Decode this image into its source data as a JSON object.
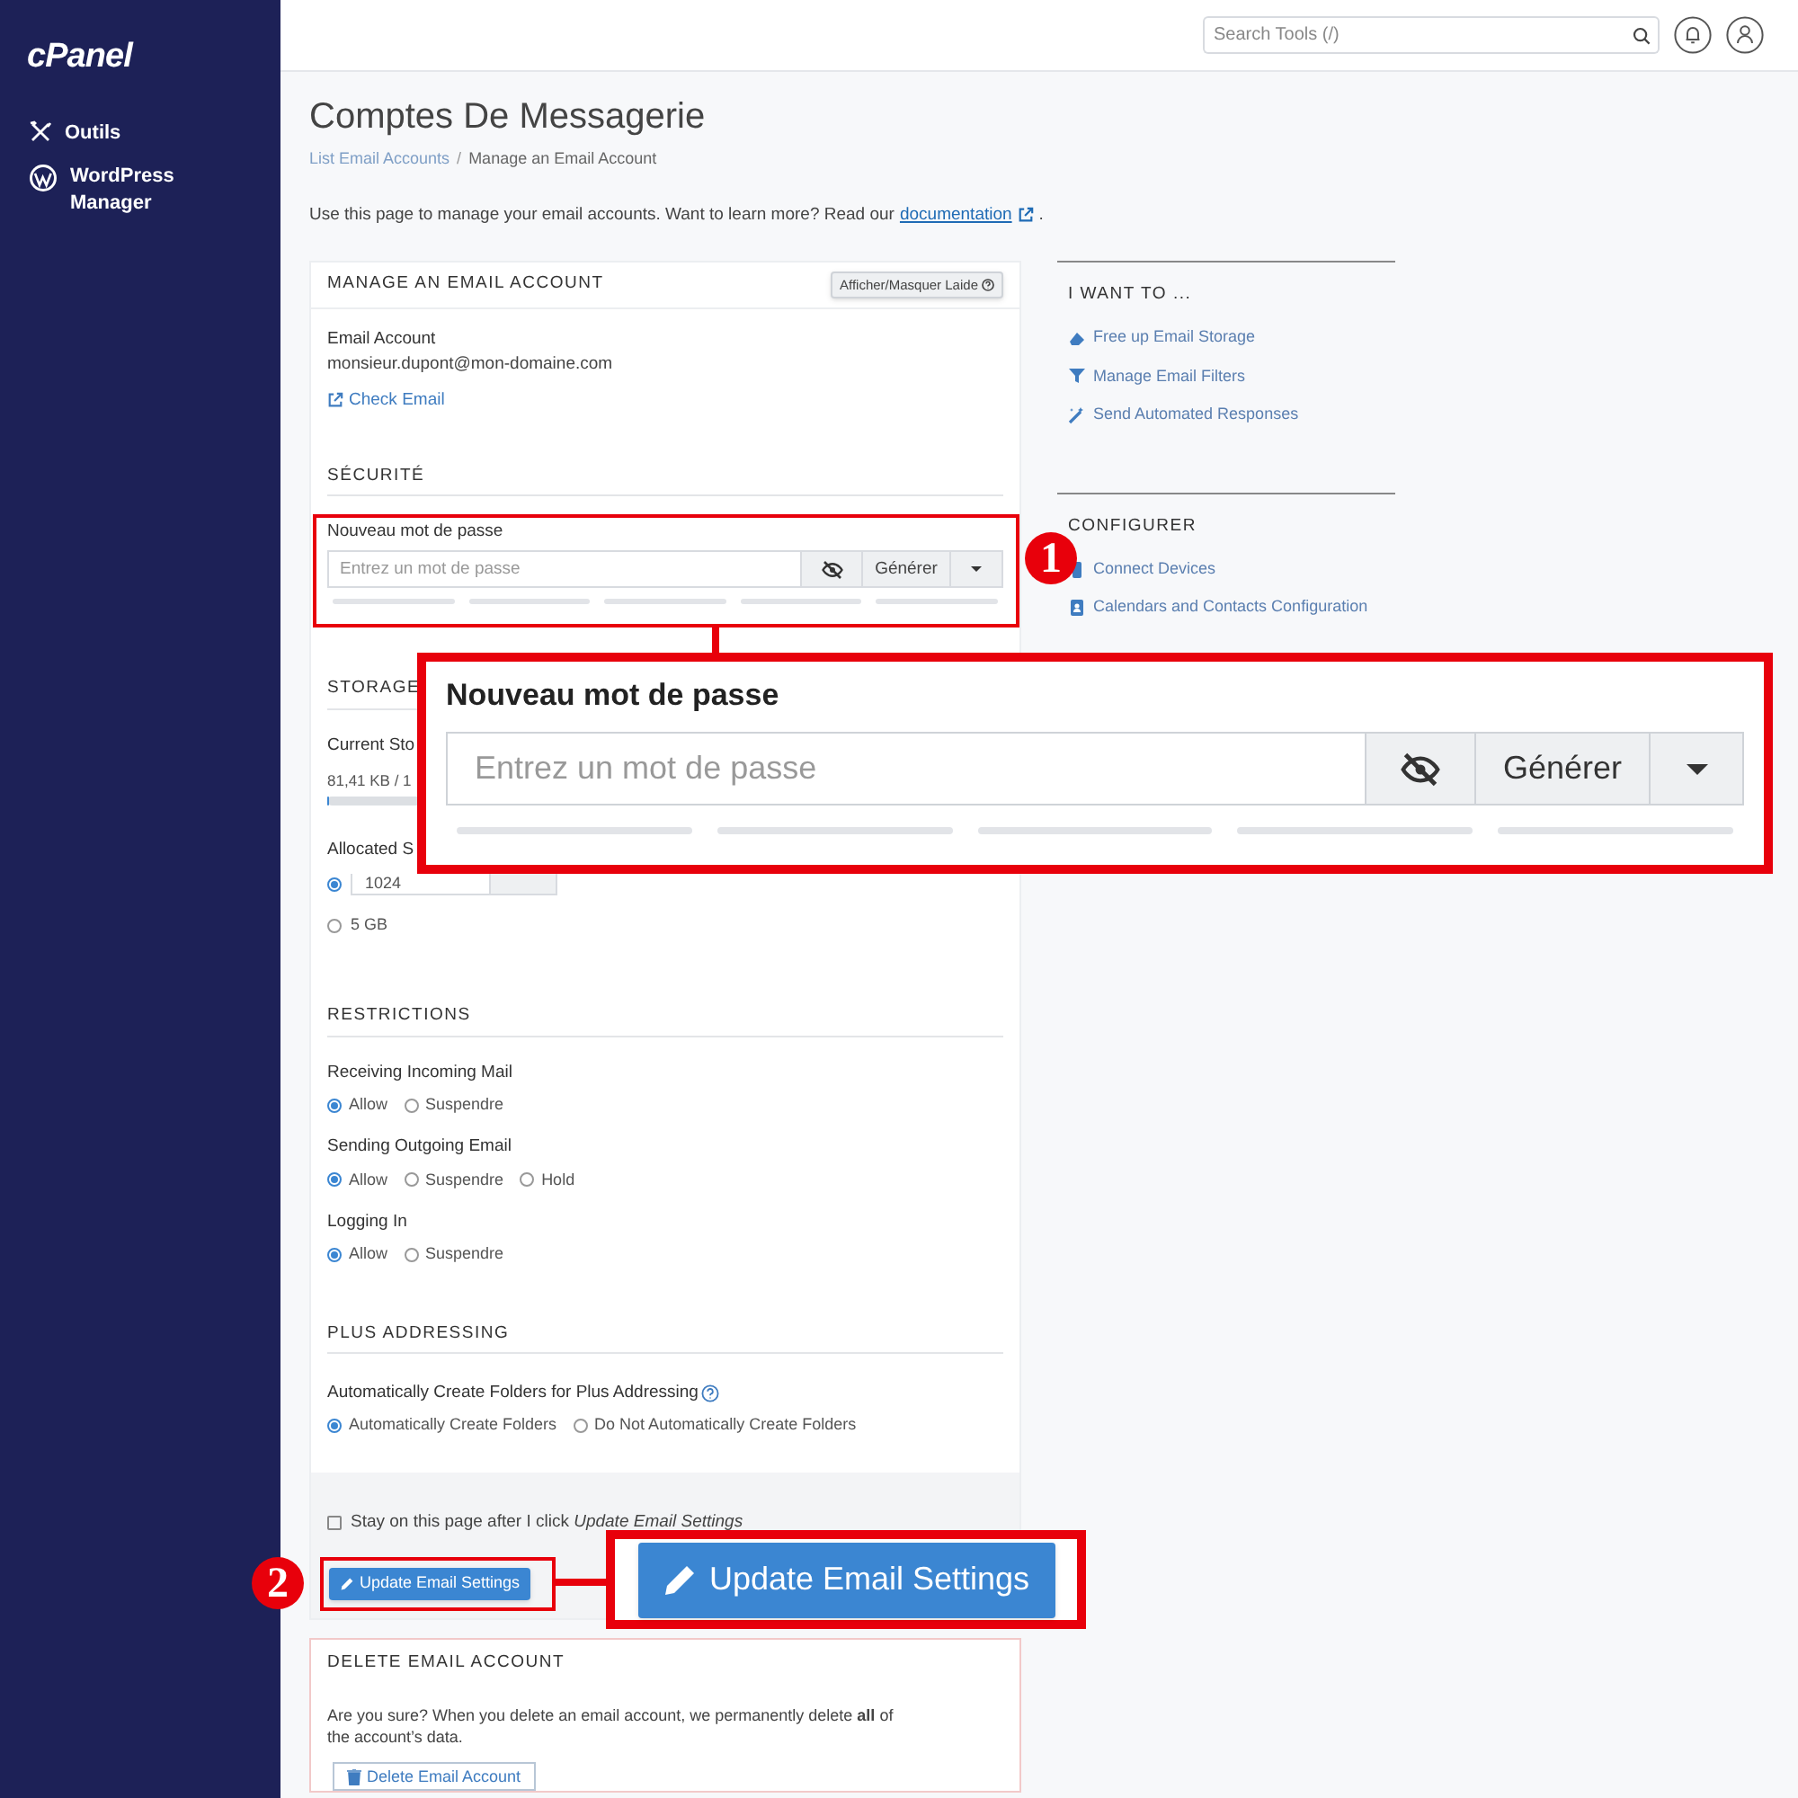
{
  "sidebar": {
    "logo": "cPanel",
    "items": [
      {
        "label": "Outils"
      },
      {
        "label": "WordPress Manager"
      }
    ]
  },
  "topbar": {
    "search": {
      "placeholder": "Search Tools (/)"
    }
  },
  "page": {
    "title": "Comptes De Messagerie",
    "breadcrumb": [
      {
        "label": "List Email Accounts",
        "link": true
      },
      {
        "label": "Manage an Email Account",
        "link": false
      }
    ],
    "breadcrumb_separator": "/",
    "description": "Use this page to manage your email accounts. Want to learn more? Read our",
    "doc_link": "documentation",
    "description_end": "."
  },
  "manage": {
    "heading": "MANAGE AN EMAIL ACCOUNT",
    "help_button": "Afficher/Masquer Laide",
    "email_label": "Email Account",
    "email_value": "monsieur.dupont@mon-domaine.com",
    "check_email": "Check Email",
    "security": {
      "heading": "SÉCURITÉ",
      "password_label": "Nouveau mot de passe",
      "placeholder": "Entrez un mot de passe",
      "generate": "Générer"
    },
    "storage": {
      "heading": "STORAGE",
      "current_label": "Current Sto",
      "current_value": "81,41 KB / 1",
      "level": 0.01,
      "allocated_label": "Allocated S",
      "options": [
        {
          "kind": "input",
          "value": "1024",
          "selected": true
        },
        {
          "kind": "text",
          "label": "5 GB",
          "selected": false
        }
      ]
    },
    "restrictions": {
      "heading": "RESTRICTIONS",
      "groups": [
        {
          "label": "Receiving Incoming Mail",
          "options": [
            {
              "label": "Allow",
              "selected": true
            },
            {
              "label": "Suspendre",
              "selected": false
            }
          ]
        },
        {
          "label": "Sending Outgoing Email",
          "options": [
            {
              "label": "Allow",
              "selected": true
            },
            {
              "label": "Suspendre",
              "selected": false
            },
            {
              "label": "Hold",
              "selected": false
            }
          ]
        },
        {
          "label": "Logging In",
          "options": [
            {
              "label": "Allow",
              "selected": true
            },
            {
              "label": "Suspendre",
              "selected": false
            }
          ]
        }
      ]
    },
    "plus": {
      "heading": "PLUS ADDRESSING",
      "question": "Automatically Create Folders for Plus Addressing",
      "options": [
        {
          "label": "Automatically Create Folders",
          "selected": true
        },
        {
          "label": "Do Not Automatically Create Folders",
          "selected": false
        }
      ]
    },
    "stay": {
      "label": "Stay on this page after I click *Update Email Settings*",
      "checked": false
    },
    "update_button": "Update Email Settings"
  },
  "delete": {
    "heading": "DELETE EMAIL ACCOUNT",
    "text": "Are you sure? When you delete an email account, we permanently delete **all** of the account’s data.",
    "button": "Delete Email Account"
  },
  "aside": [
    {
      "heading": "I WANT TO ...",
      "links": [
        {
          "label": "Free up Email Storage"
        },
        {
          "label": "Manage Email Filters"
        },
        {
          "label": "Send Automated Responses"
        }
      ]
    },
    {
      "heading": "CONFIGURER",
      "links": [
        {
          "label": "Connect Devices"
        },
        {
          "label": "Calendars and Contacts Configuration"
        }
      ]
    }
  ],
  "callouts": [
    {
      "number": "1",
      "label": "Nouveau mot de passe",
      "placeholder": "Entrez un mot de passe",
      "generate": "Générer"
    },
    {
      "number": "2",
      "button": "Update Email Settings"
    }
  ]
}
